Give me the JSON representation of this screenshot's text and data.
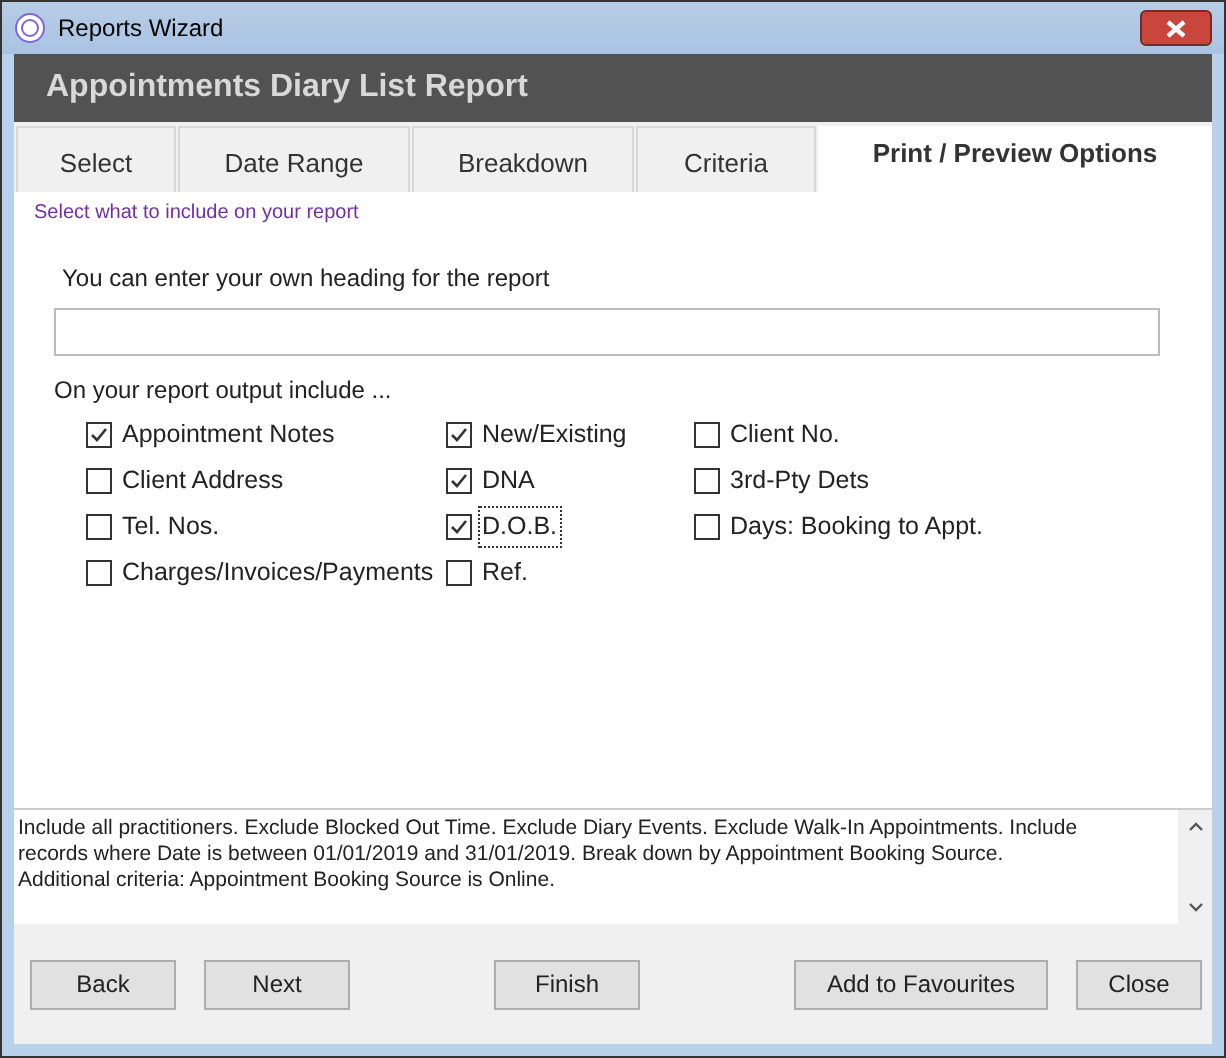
{
  "window": {
    "title": "Reports Wizard"
  },
  "header": "Appointments Diary List Report",
  "tabs": [
    {
      "label": "Select",
      "selected": false
    },
    {
      "label": "Date Range",
      "selected": false
    },
    {
      "label": "Breakdown",
      "selected": false
    },
    {
      "label": "Criteria",
      "selected": false
    },
    {
      "label": "Print / Preview Options",
      "selected": true
    }
  ],
  "instruction": "Select what to include on your report",
  "heading_label": "You can enter your own heading for the report",
  "include_label": "On your report output include ...",
  "columns": [
    [
      {
        "label": "Appointment Notes",
        "checked": true,
        "focused": false
      },
      {
        "label": "Client Address",
        "checked": false,
        "focused": false
      },
      {
        "label": "Tel. Nos.",
        "checked": false,
        "focused": false
      },
      {
        "label": "Charges/Invoices/Payments",
        "checked": false,
        "focused": false
      }
    ],
    [
      {
        "label": "New/Existing",
        "checked": true,
        "focused": false
      },
      {
        "label": "DNA",
        "checked": true,
        "focused": false
      },
      {
        "label": "D.O.B.",
        "checked": true,
        "focused": true
      },
      {
        "label": "Ref.",
        "checked": false,
        "focused": false
      }
    ],
    [
      {
        "label": "Client No.",
        "checked": false,
        "focused": false
      },
      {
        "label": "3rd-Pty Dets",
        "checked": false,
        "focused": false
      },
      {
        "label": "Days: Booking to Appt.",
        "checked": false,
        "focused": false
      }
    ]
  ],
  "summary": "Include all practitioners. Exclude Blocked Out Time. Exclude Diary Events. Exclude Walk-In Appointments. Include records where Date is between 01/01/2019 and 31/01/2019. Break down by Appointment Booking Source. Additional criteria: Appointment Booking Source is Online.",
  "button_groups": [
    [
      {
        "label": "Back"
      },
      {
        "label": "Next"
      }
    ],
    [
      {
        "label": "Finish"
      }
    ],
    [
      {
        "label": "Add to Favourites"
      },
      {
        "label": "Close"
      }
    ]
  ]
}
